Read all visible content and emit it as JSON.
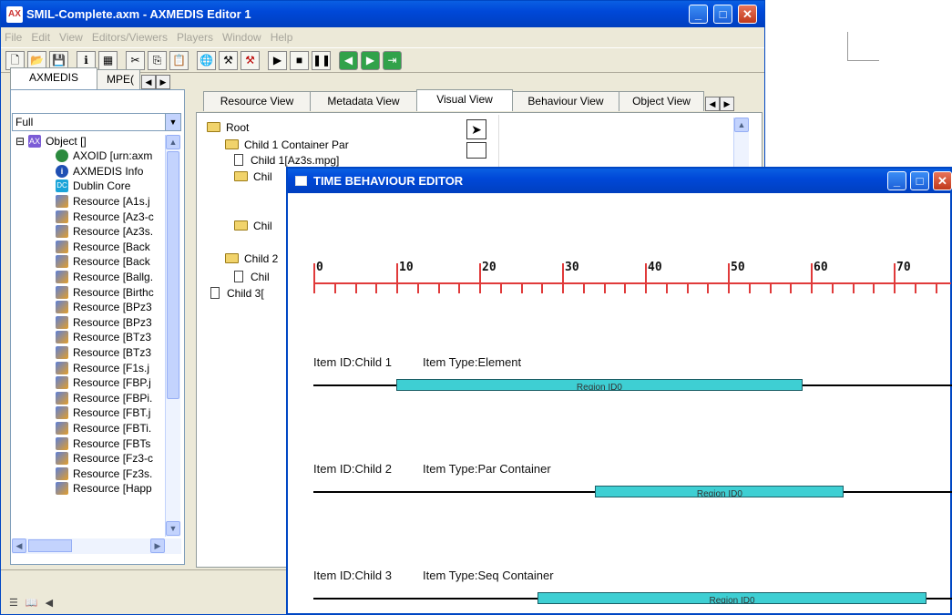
{
  "main_window": {
    "title": "SMIL-Complete.axm - AXMEDIS Editor 1",
    "menu": [
      "File",
      "Edit",
      "View",
      "Editors/Viewers",
      "Players",
      "Window",
      "Help"
    ]
  },
  "left_tabs": [
    "AXMEDIS",
    "MPE("
  ],
  "left_select_value": "Full",
  "tree_items": [
    {
      "label": "Object []",
      "icon": "object-icon"
    },
    {
      "label": "AXOID [urn:axm",
      "icon": "globe-icon"
    },
    {
      "label": "AXMEDIS Info",
      "icon": "info-icon"
    },
    {
      "label": "Dublin Core",
      "icon": "dublin-core-icon"
    },
    {
      "label": "Resource [A1s.j",
      "icon": "resource-icon"
    },
    {
      "label": "Resource [Az3-c",
      "icon": "resource-icon"
    },
    {
      "label": "Resource [Az3s.",
      "icon": "resource-icon"
    },
    {
      "label": "Resource [Back",
      "icon": "resource-icon"
    },
    {
      "label": "Resource [Back",
      "icon": "resource-icon"
    },
    {
      "label": "Resource [Ballg.",
      "icon": "resource-icon"
    },
    {
      "label": "Resource [Birthc",
      "icon": "resource-icon"
    },
    {
      "label": "Resource [BPz3",
      "icon": "resource-icon"
    },
    {
      "label": "Resource [BPz3",
      "icon": "resource-icon"
    },
    {
      "label": "Resource [BTz3",
      "icon": "resource-icon"
    },
    {
      "label": "Resource [BTz3",
      "icon": "resource-icon"
    },
    {
      "label": "Resource [F1s.j",
      "icon": "resource-icon"
    },
    {
      "label": "Resource [FBP.j",
      "icon": "resource-icon"
    },
    {
      "label": "Resource [FBPi.",
      "icon": "resource-icon"
    },
    {
      "label": "Resource [FBT.j",
      "icon": "resource-icon"
    },
    {
      "label": "Resource [FBTi.",
      "icon": "resource-icon"
    },
    {
      "label": "Resource [FBTs",
      "icon": "resource-icon"
    },
    {
      "label": "Resource [Fz3-c",
      "icon": "resource-icon"
    },
    {
      "label": "Resource [Fz3s.",
      "icon": "resource-icon"
    },
    {
      "label": "Resource [Happ",
      "icon": "resource-icon"
    }
  ],
  "view_tabs": [
    "Resource View",
    "Metadata View",
    "Visual View",
    "Behaviour View",
    "Object View"
  ],
  "active_view_tab": "Visual View",
  "visual_tree": [
    {
      "label": "Root",
      "type": "folder"
    },
    {
      "label": "Child 1 Container Par",
      "type": "folder"
    },
    {
      "label": "Child 1[Az3s.mpg]",
      "type": "doc"
    },
    {
      "label": "Chil",
      "type": "folder"
    },
    {
      "label": "Chil",
      "type": "folder"
    },
    {
      "label": "Child 2",
      "type": "folder"
    },
    {
      "label": "Chil",
      "type": "doc"
    },
    {
      "label": "Child 3[",
      "type": "doc"
    }
  ],
  "time_editor": {
    "title": "TIME BEHAVIOUR EDITOR",
    "ruler_labels": [
      "0",
      "10",
      "20",
      "30",
      "40",
      "50",
      "60",
      "70"
    ],
    "items": [
      {
        "id": "Item ID:Child 1",
        "type": "Item Type:Element",
        "bar_label": "Region ID0",
        "start": 10,
        "end": 59
      },
      {
        "id": "Item ID:Child 2",
        "type": "Item Type:Par Container",
        "bar_label": "Region ID0",
        "start": 34,
        "end": 64
      },
      {
        "id": "Item ID:Child 3",
        "type": "Item Type:Seq Container",
        "bar_label": "Region ID0",
        "start": 27,
        "end": 74
      }
    ]
  }
}
